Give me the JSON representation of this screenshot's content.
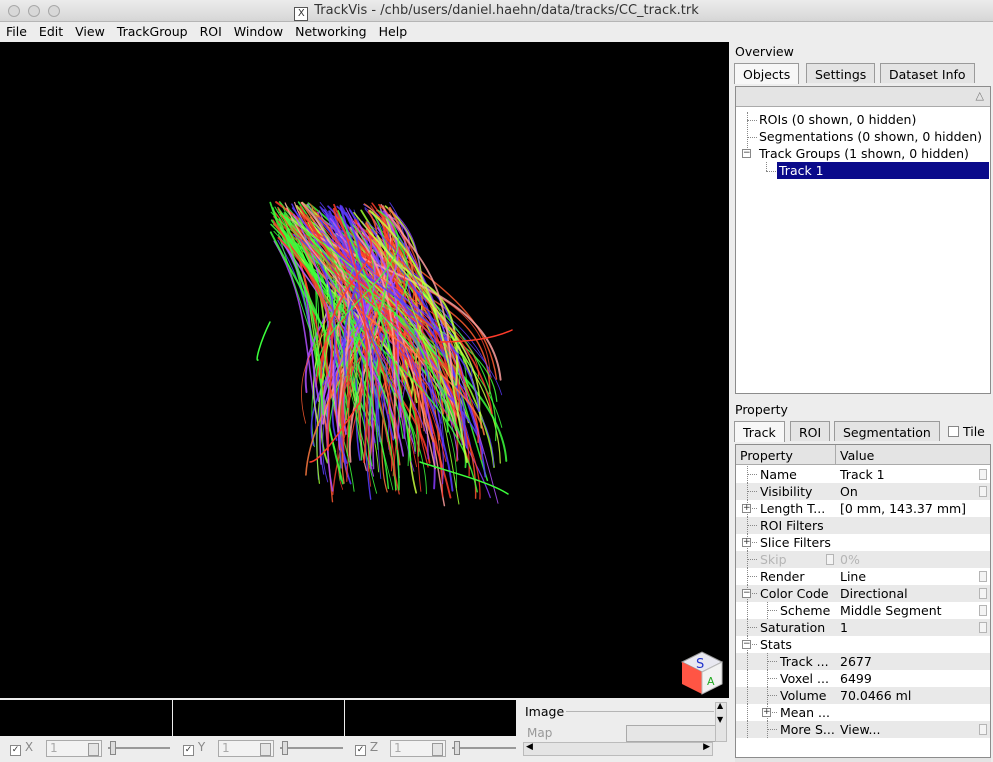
{
  "window": {
    "title": "TrackVis - /chb/users/daniel.haehn/data/tracks/CC_track.trk",
    "x11_icon": "X"
  },
  "menu": [
    "File",
    "Edit",
    "View",
    "TrackGroup",
    "ROI",
    "Window",
    "Networking",
    "Help"
  ],
  "cube": {
    "letters": [
      "S",
      "A"
    ]
  },
  "slices": [
    {
      "axis": "X",
      "checked": true,
      "value": "1"
    },
    {
      "axis": "Y",
      "checked": true,
      "value": "1"
    },
    {
      "axis": "Z",
      "checked": true,
      "value": "1"
    }
  ],
  "image_panel": {
    "title": "Image",
    "map_label": "Map"
  },
  "overview": {
    "title": "Overview",
    "tabs": [
      "Objects",
      "Settings",
      "Dataset Info"
    ],
    "active_tab": "Objects",
    "tree": [
      {
        "label": "ROIs (0 shown, 0 hidden)",
        "level": 0
      },
      {
        "label": "Segmentations (0 shown, 0 hidden)",
        "level": 0
      },
      {
        "label": "Track Groups (1 shown, 0 hidden)",
        "level": 0,
        "expand": "minus"
      },
      {
        "label": "Track 1",
        "level": 1,
        "selected": true
      }
    ]
  },
  "property": {
    "title": "Property",
    "tabs": [
      "Track",
      "ROI",
      "Segmentation"
    ],
    "active_tab": "Track",
    "tile_label": "Tile",
    "tile_checked": false,
    "headers": [
      "Property",
      "Value"
    ],
    "rows": [
      {
        "name": "Name",
        "value": "Track 1",
        "level": 0
      },
      {
        "name": "Visibility",
        "value": "On",
        "level": 0
      },
      {
        "name": "Length T...",
        "value": "[0 mm,  143.37 mm]",
        "level": 0,
        "expand": "plus"
      },
      {
        "name": "ROI Filters",
        "value": "",
        "level": 0
      },
      {
        "name": "Slice Filters",
        "value": "",
        "level": 0,
        "expand": "plus"
      },
      {
        "name": "Skip",
        "value": "0%",
        "level": 0,
        "disabled": true
      },
      {
        "name": "Render",
        "value": "Line",
        "level": 0
      },
      {
        "name": "Color Code",
        "value": "Directional",
        "level": 0,
        "expand": "minus"
      },
      {
        "name": "Scheme",
        "value": "Middle Segment",
        "level": 1
      },
      {
        "name": "Saturation",
        "value": "1",
        "level": 0
      },
      {
        "name": "Stats",
        "value": "",
        "level": 0,
        "expand": "minus"
      },
      {
        "name": "Track ...",
        "value": "2677",
        "level": 1
      },
      {
        "name": "Voxel ...",
        "value": "6499",
        "level": 1
      },
      {
        "name": "Volume",
        "value": "70.0466 ml",
        "level": 1
      },
      {
        "name": "Mean ...",
        "value": "",
        "level": 1,
        "expand": "plus"
      },
      {
        "name": "More S...",
        "value": "View...",
        "level": 1
      }
    ]
  },
  "colors": {
    "selection": "#0a0a8a",
    "fiber_red": "#ff3b2a",
    "fiber_green": "#3cff3c",
    "fiber_blue": "#5a3cff"
  }
}
